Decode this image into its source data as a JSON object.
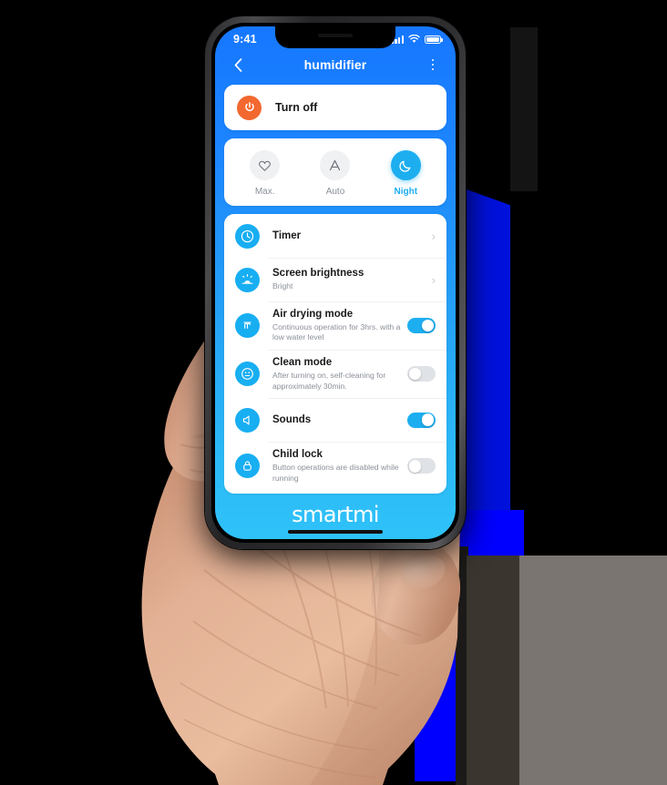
{
  "phone": {
    "status_bar": {
      "time": "9:41",
      "signal_icon": "cellular-signal-icon",
      "wifi_icon": "wifi-icon",
      "battery_icon": "battery-full-icon"
    },
    "nav": {
      "back_icon": "chevron-left-icon",
      "title": "humidifier",
      "menu_icon": "more-vertical-icon"
    },
    "power": {
      "icon": "power-icon",
      "label": "Turn off",
      "accent": "#F2682F"
    },
    "modes": {
      "items": [
        {
          "label": "Max.",
          "icon": "heart-icon",
          "active": false
        },
        {
          "label": "Auto",
          "icon": "letter-a-icon",
          "active": false
        },
        {
          "label": "Night",
          "icon": "moon-icon",
          "active": true
        }
      ],
      "active_color": "#1DAEF0",
      "inactive_color": "#8A8F98"
    },
    "settings": [
      {
        "name": "timer",
        "icon": "clock-icon",
        "title": "Timer",
        "subtitle": "",
        "control": "chevron",
        "chevron": "›"
      },
      {
        "name": "screen-brightness",
        "icon": "brightness-icon",
        "title": "Screen brightness",
        "subtitle": "Bright",
        "control": "chevron",
        "chevron": "›"
      },
      {
        "name": "air-drying-mode",
        "icon": "air-waves-icon",
        "title": "Air drying mode",
        "subtitle": "Continuous operation for 3hrs. with a low water level",
        "control": "toggle",
        "toggle_on": true
      },
      {
        "name": "clean-mode",
        "icon": "clean-circle-icon",
        "title": "Clean mode",
        "subtitle": "After turning on, self-cleaning for approximately 30min.",
        "control": "toggle",
        "toggle_on": false
      },
      {
        "name": "sounds",
        "icon": "speaker-icon",
        "title": "Sounds",
        "subtitle": "",
        "control": "toggle",
        "toggle_on": true
      },
      {
        "name": "child-lock",
        "icon": "lock-icon",
        "title": "Child lock",
        "subtitle": "Button operations are disabled while running",
        "control": "toggle",
        "toggle_on": false
      }
    ],
    "brand": "smartmi",
    "home_indicator": "home-indicator",
    "screen_gradient_top": "#1677FF",
    "screen_gradient_bottom": "#2FC2F8"
  }
}
